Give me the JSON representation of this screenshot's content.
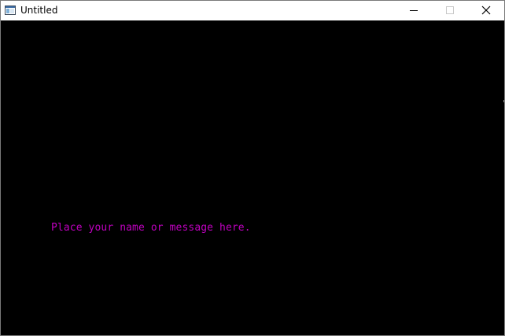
{
  "window": {
    "title": "Untitled"
  },
  "title_controls": {
    "minimize_icon": "minimize-icon",
    "maximize_icon": "maximize-icon",
    "close_icon": "close-icon"
  },
  "canvas": {
    "message": "Place your name or message here.",
    "background_color": "#000000",
    "text_color": "#c000c0"
  }
}
